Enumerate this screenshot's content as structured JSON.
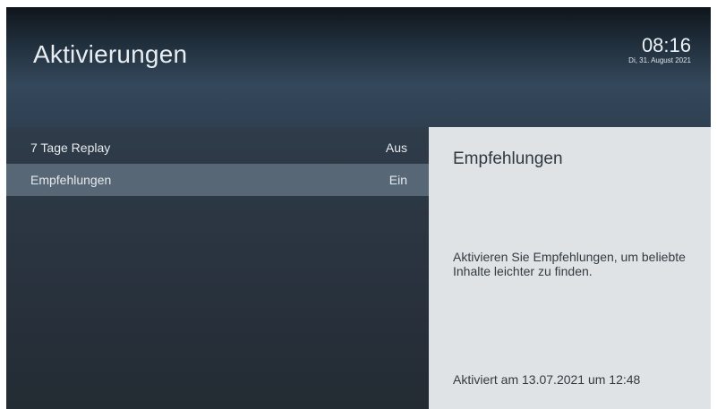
{
  "header": {
    "title": "Aktivierungen",
    "time": "08:16",
    "date": "Di, 31. August 2021"
  },
  "settings": [
    {
      "label": "7 Tage Replay",
      "value": "Aus",
      "selected": false
    },
    {
      "label": "Empfehlungen",
      "value": "Ein",
      "selected": true
    }
  ],
  "detail": {
    "title": "Empfehlungen",
    "description": "Aktivieren Sie Empfehlungen, um beliebte Inhalte leichter zu finden.",
    "activated": "Aktiviert am 13.07.2021 um 12:48"
  },
  "colors": {
    "selected_row": "#586775",
    "detail_panel": "#dfe3e6"
  }
}
